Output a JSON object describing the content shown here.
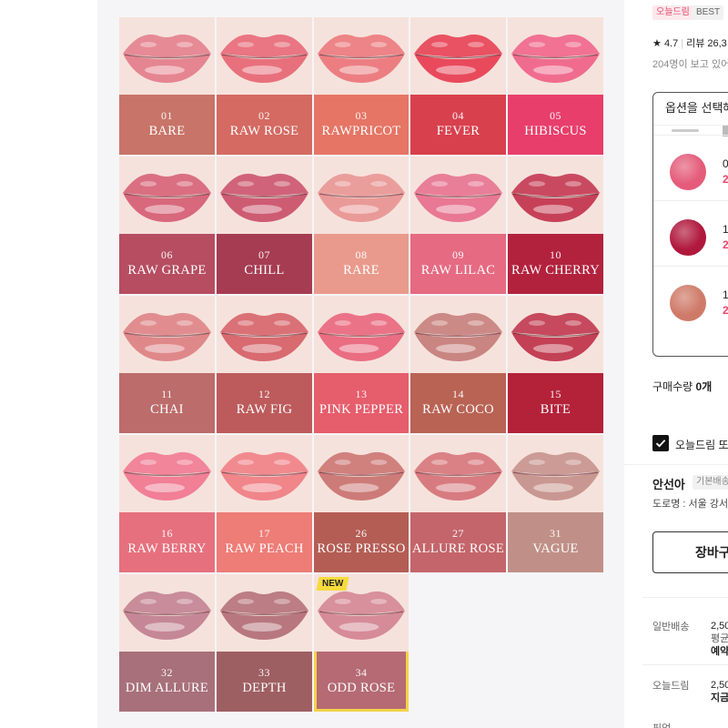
{
  "product_image": {
    "new_badge": "NEW",
    "shades": [
      {
        "num": "01",
        "name": "BARE",
        "lip": "#e58591",
        "panel": "#c87468"
      },
      {
        "num": "02",
        "name": "RAW ROSE",
        "lip": "#e8707c",
        "panel": "#d46a62"
      },
      {
        "num": "03",
        "name": "RAWPRICOT",
        "lip": "#ec7e82",
        "panel": "#e67565"
      },
      {
        "num": "04",
        "name": "FEVER",
        "lip": "#e84a5c",
        "panel": "#d8404d"
      },
      {
        "num": "05",
        "name": "HIBISCUS",
        "lip": "#f06c8e",
        "panel": "#e83e6b"
      },
      {
        "num": "06",
        "name": "RAW GRAPE",
        "lip": "#d8687c",
        "panel": "#b64d61"
      },
      {
        "num": "07",
        "name": "CHILL",
        "lip": "#cd5c73",
        "panel": "#a63c52"
      },
      {
        "num": "08",
        "name": "RARE",
        "lip": "#e99a98",
        "panel": "#e99a8c"
      },
      {
        "num": "09",
        "name": "RAW LILAC",
        "lip": "#e87894",
        "panel": "#e56a82"
      },
      {
        "num": "10",
        "name": "RAW CHERRY",
        "lip": "#c64158",
        "panel": "#b2223d"
      },
      {
        "num": "11",
        "name": "CHAI",
        "lip": "#df888a",
        "panel": "#bc6c6a"
      },
      {
        "num": "12",
        "name": "RAW FIG",
        "lip": "#d86a70",
        "panel": "#bd5b5c"
      },
      {
        "num": "13",
        "name": "PINK PEPPER",
        "lip": "#ea6d82",
        "panel": "#e65d6c"
      },
      {
        "num": "14",
        "name": "RAW COCO",
        "lip": "#c98581",
        "panel": "#b96354"
      },
      {
        "num": "15",
        "name": "BITE",
        "lip": "#c34055",
        "panel": "#b4223a"
      },
      {
        "num": "16",
        "name": "RAW BERRY",
        "lip": "#f17f96",
        "panel": "#e6707e"
      },
      {
        "num": "17",
        "name": "RAW PEACH",
        "lip": "#f0858a",
        "panel": "#ee7c77"
      },
      {
        "num": "26",
        "name": "ROSE PRESSO",
        "lip": "#cd7b78",
        "panel": "#b45d55"
      },
      {
        "num": "27",
        "name": "ALLURE ROSE",
        "lip": "#d87b80",
        "panel": "#c4656b"
      },
      {
        "num": "31",
        "name": "VAGUE",
        "lip": "#c99791",
        "panel": "#c09088"
      },
      {
        "num": "32",
        "name": "DIM ALLURE",
        "lip": "#c58796",
        "panel": "#a8707b"
      },
      {
        "num": "33",
        "name": "DEPTH",
        "lip": "#b8777e",
        "panel": "#9e5f62"
      },
      {
        "num": "34",
        "name": "ODD ROSE",
        "lip": "#d68b98",
        "panel": "#b56a74"
      }
    ]
  },
  "right_panel": {
    "tag_oneul": "오늘드림",
    "tag_best": "BEST",
    "rating": "4.7",
    "review_label": "리뷰 26,3",
    "viewers": "204명이 보고 있어",
    "option_header": "옵션을 선택해",
    "options": [
      {
        "num": "0",
        "price": "2",
        "color": "#e45c7a"
      },
      {
        "num": "1",
        "price": "2",
        "color": "#b0183c"
      },
      {
        "num": "1",
        "price": "2",
        "color": "#cf7a68"
      }
    ],
    "qty_label": "구매수량",
    "qty_value": "0개",
    "delivery_check_label": "오늘드림 또",
    "seller_name": "안선아",
    "seller_tag": "기본배송",
    "seller_addr": "도로명 : 서울 강서",
    "cart_button": "장바구",
    "shipping": [
      {
        "label": "일반배송",
        "lines": [
          "2,50",
          "평균",
          "예약"
        ]
      },
      {
        "label": "오늘드림",
        "lines": [
          "2,50",
          "지금"
        ]
      }
    ],
    "bottom_label": "픽업"
  }
}
